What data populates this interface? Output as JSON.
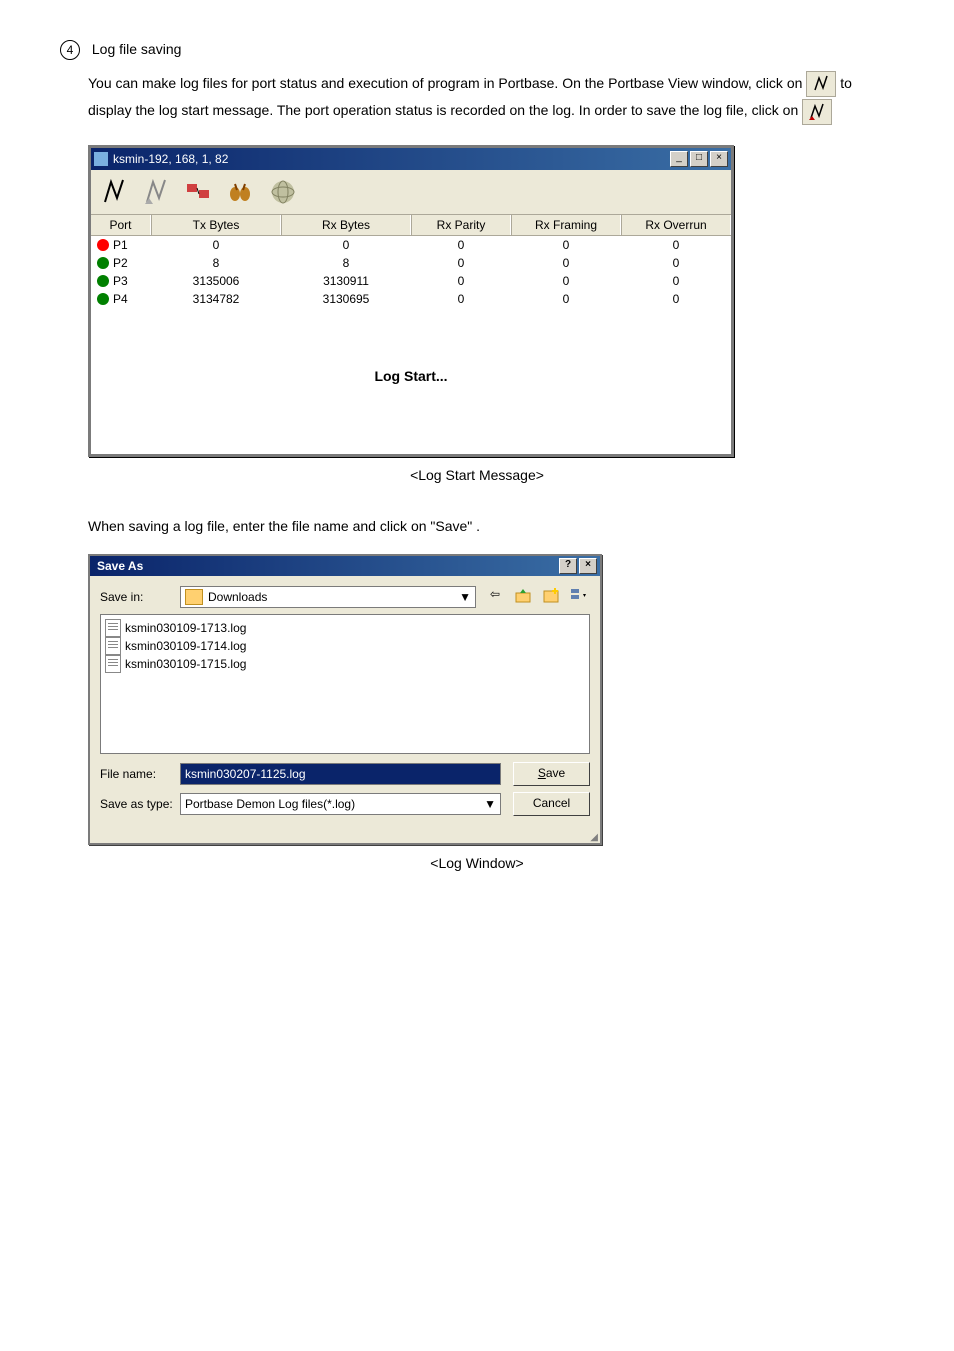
{
  "section": {
    "number": "4",
    "title": "Log file saving",
    "para1a": "You can make log files for port status and execution of program in Portbase. On the Portbase View window, click on ",
    "para1b": " to display the log start message. The port operation status is recorded on the log. In order to save the log file, click on ",
    "para2": "When saving a log file, enter the file name and click on \"Save\" ."
  },
  "window1": {
    "title": "ksmin-192, 168, 1, 82",
    "headers": {
      "port": "Port",
      "tx": "Tx Bytes",
      "rx": "Rx Bytes",
      "parity": "Rx Parity",
      "framing": "Rx Framing",
      "overrun": "Rx Overrun"
    },
    "rows": [
      {
        "port": "P1",
        "color": "#ff0000",
        "tx": "0",
        "rx": "0",
        "parity": "0",
        "framing": "0",
        "overrun": "0"
      },
      {
        "port": "P2",
        "color": "#008000",
        "tx": "8",
        "rx": "8",
        "parity": "0",
        "framing": "0",
        "overrun": "0"
      },
      {
        "port": "P3",
        "color": "#008000",
        "tx": "3135006",
        "rx": "3130911",
        "parity": "0",
        "framing": "0",
        "overrun": "0"
      },
      {
        "port": "P4",
        "color": "#008000",
        "tx": "3134782",
        "rx": "3130695",
        "parity": "0",
        "framing": "0",
        "overrun": "0"
      }
    ],
    "log_start": "Log Start..."
  },
  "caption1": "<Log Start Message>",
  "caption2": "<Log Window>",
  "save_dialog": {
    "title": "Save As",
    "save_in_label": "Save in:",
    "save_in_value": "Downloads",
    "files": [
      "ksmin030109-1713.log",
      "ksmin030109-1714.log",
      "ksmin030109-1715.log"
    ],
    "filename_label": "File name:",
    "filename_value": "ksmin030207-1125.log",
    "type_label": "Save as type:",
    "type_value": "Portbase Demon Log files(*.log)",
    "save_btn": "Save",
    "cancel_btn": "Cancel"
  }
}
